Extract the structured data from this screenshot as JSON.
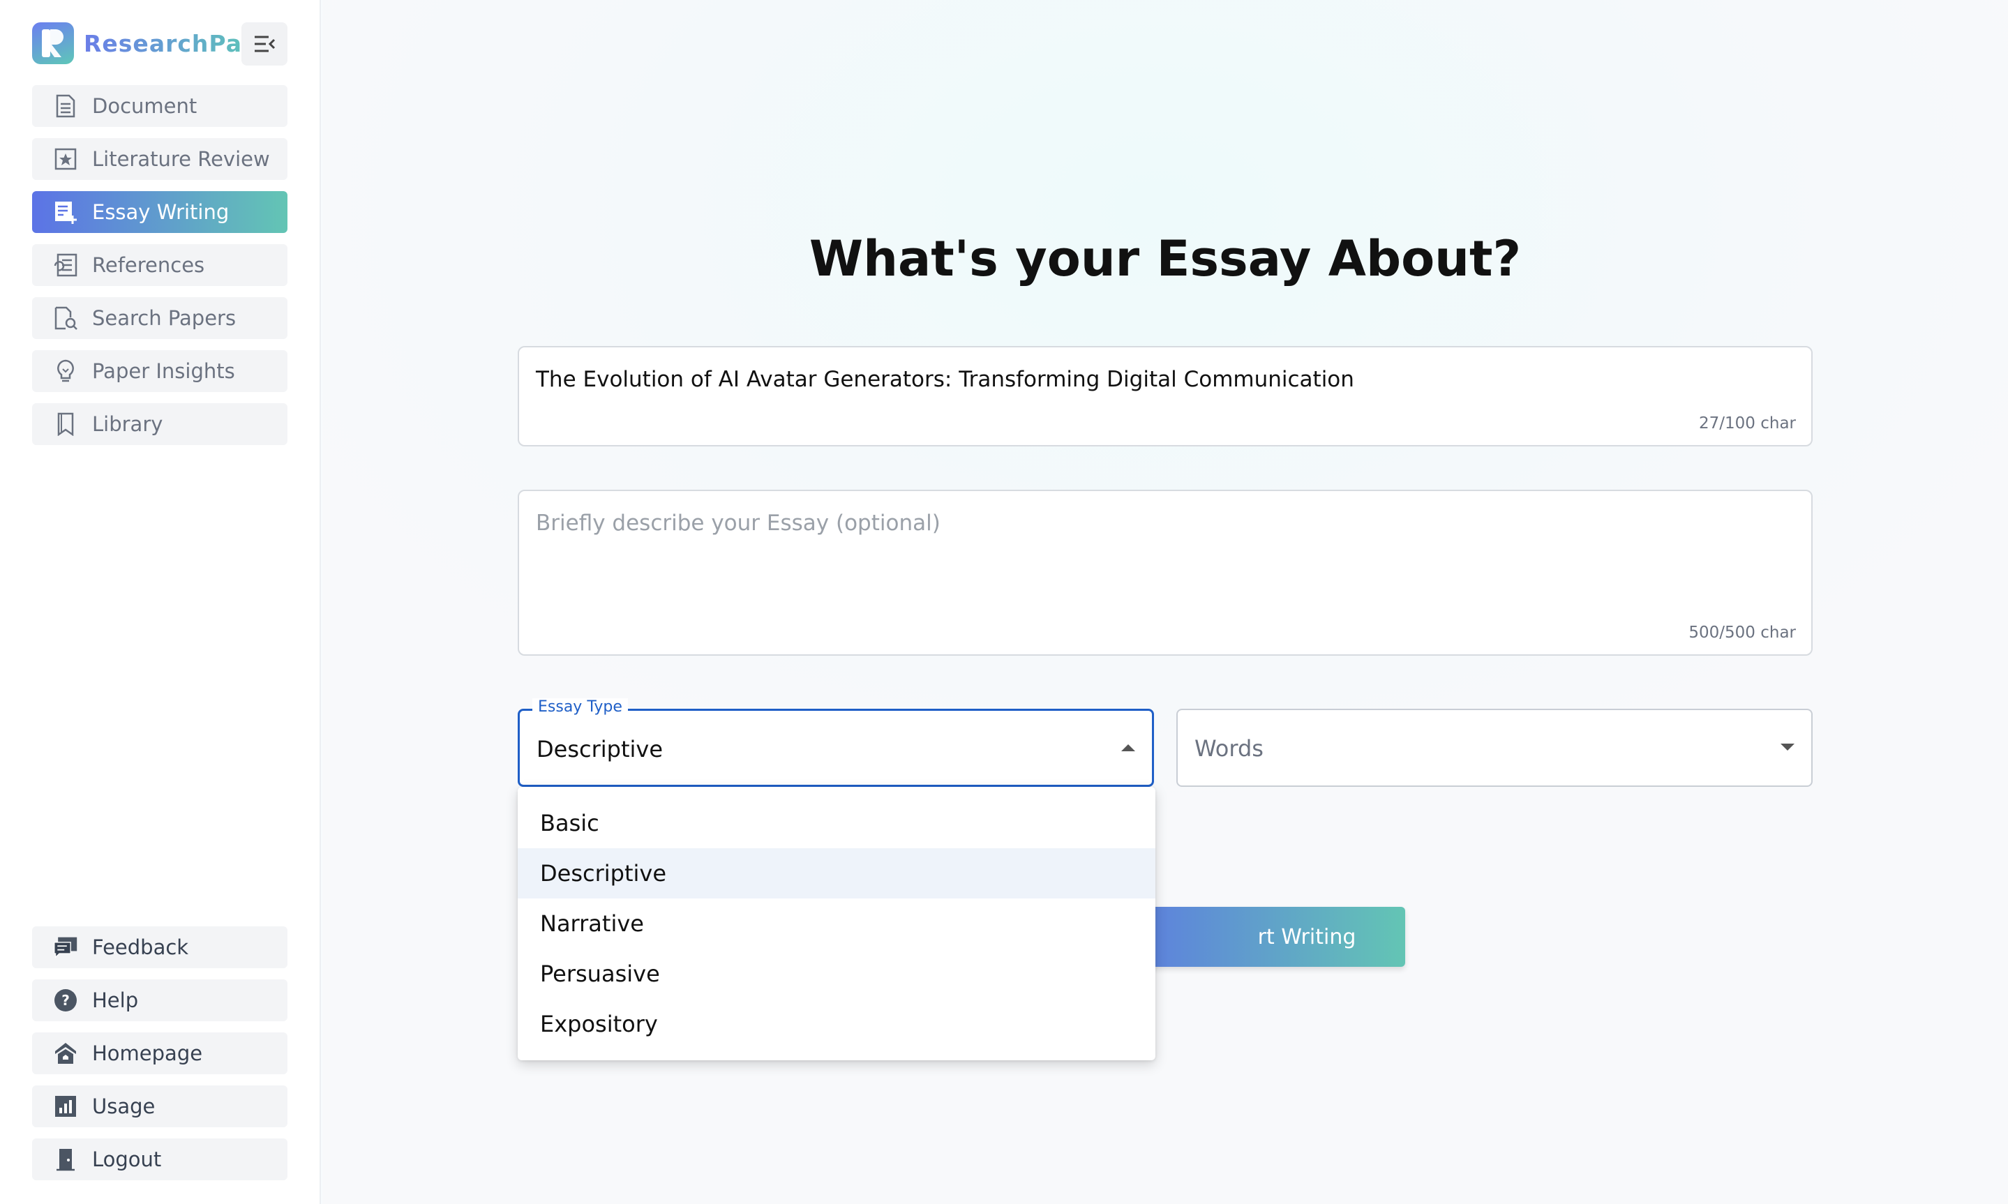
{
  "app": {
    "brand": "ResearchPal"
  },
  "sidebar": {
    "top_items": [
      {
        "label": "Document",
        "icon": "document-icon"
      },
      {
        "label": "Literature Review",
        "icon": "star-box-icon"
      },
      {
        "label": "Essay Writing",
        "icon": "essay-edit-icon",
        "active": true
      },
      {
        "label": "References",
        "icon": "references-icon"
      },
      {
        "label": "Search Papers",
        "icon": "search-document-icon"
      },
      {
        "label": "Paper Insights",
        "icon": "lightbulb-icon"
      },
      {
        "label": "Library",
        "icon": "bookmark-icon"
      }
    ],
    "bottom_items": [
      {
        "label": "Feedback",
        "icon": "feedback-icon"
      },
      {
        "label": "Help",
        "icon": "help-icon"
      },
      {
        "label": "Homepage",
        "icon": "home-icon"
      },
      {
        "label": "Usage",
        "icon": "usage-chart-icon"
      },
      {
        "label": "Logout",
        "icon": "logout-door-icon"
      }
    ]
  },
  "main": {
    "title": "What's your Essay About?",
    "topic": {
      "value": "The Evolution of AI Avatar Generators: Transforming Digital Communication",
      "counter": "27/100 char"
    },
    "description": {
      "placeholder": "Briefly describe your Essay (optional)",
      "counter": "500/500 char"
    },
    "essay_type": {
      "label": "Essay Type",
      "value": "Descriptive",
      "options": [
        "Basic",
        "Descriptive",
        "Narrative",
        "Persuasive",
        "Expository"
      ]
    },
    "words": {
      "placeholder": "Words"
    },
    "start_button": "rt Writing"
  },
  "colors": {
    "accent_start": "#5c73e6",
    "accent_end": "#63c5b4",
    "focus_blue": "#1f5fc7"
  }
}
